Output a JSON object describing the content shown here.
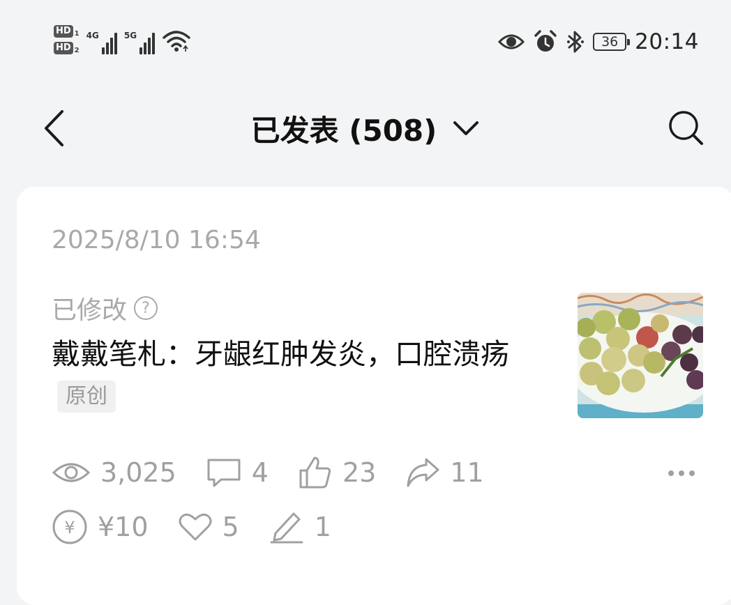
{
  "status_bar": {
    "sim1_label": "HD",
    "sim1_num": "1",
    "sim2_label": "HD",
    "sim2_num": "2",
    "net1": "4G",
    "net2": "5G",
    "battery": "36",
    "time": "20:14",
    "icons": [
      "eye-icon",
      "alarm-icon",
      "bluetooth-icon",
      "battery-icon"
    ]
  },
  "header": {
    "title": "已发表 (508)",
    "icons": [
      "back-icon",
      "chevron-down-icon",
      "search-icon"
    ]
  },
  "post": {
    "time": "2025/8/10 16:54",
    "modified_label": "已修改",
    "help_symbol": "?",
    "title": "戴戴笔札：牙龈红肿发炎，口腔溃疡",
    "tag": "原创",
    "stats": {
      "views": "3,025",
      "comments": "4",
      "likes": "23",
      "shares": "11",
      "reward": "¥10",
      "favorites": "5",
      "edits": "1"
    },
    "yen_symbol": "¥"
  },
  "colors": {
    "background": "#f3f4f5",
    "card": "#ffffff",
    "muted_text": "#a0a0a0",
    "title_text": "#111111",
    "tag_bg": "#f0f0f0"
  }
}
